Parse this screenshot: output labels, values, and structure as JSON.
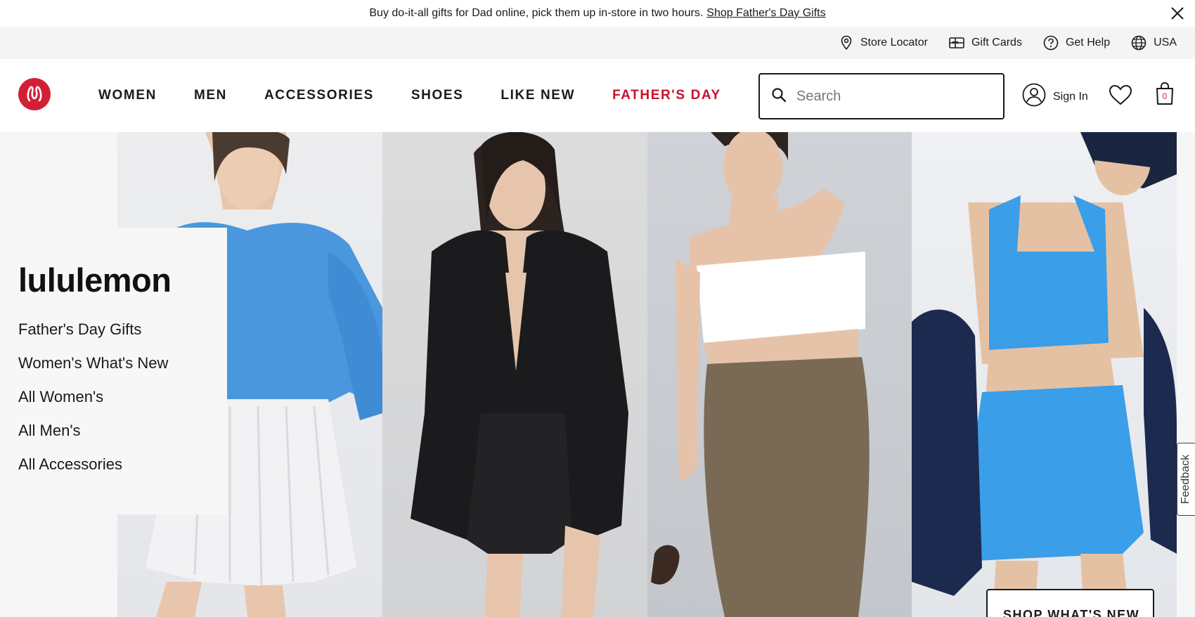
{
  "promo": {
    "text": "Buy do-it-all gifts for Dad online, pick them up in-store in two hours.",
    "link": "Shop Father's Day Gifts"
  },
  "utility": {
    "items": [
      {
        "label": "Store Locator",
        "icon": "map-pin-icon"
      },
      {
        "label": "Gift Cards",
        "icon": "gift-card-icon"
      },
      {
        "label": "Get Help",
        "icon": "help-circle-icon"
      },
      {
        "label": "USA",
        "icon": "globe-icon"
      }
    ]
  },
  "nav": {
    "logo": "lululemon-logo",
    "links": [
      {
        "label": "WOMEN"
      },
      {
        "label": "MEN"
      },
      {
        "label": "ACCESSORIES"
      },
      {
        "label": "SHOES"
      },
      {
        "label": "LIKE NEW"
      },
      {
        "label": "FATHER'S DAY",
        "highlight": true
      }
    ],
    "search_placeholder": "Search",
    "sign_in": "Sign In",
    "bag_count": "0"
  },
  "hero": {
    "brand": "lululemon",
    "links": [
      "Father's Day Gifts",
      "Women's What's New",
      "All Women's",
      "All Men's",
      "All Accessories"
    ],
    "cta": "SHOP WHAT'S NEW",
    "feedback": "Feedback",
    "panels": [
      "model-blue-sweatshirt-white-skirt",
      "model-black-shirt-black-shorts",
      "model-white-bandeau-olive-skirt",
      "model-blue-bra-blue-skirt"
    ]
  },
  "colors": {
    "brand_red": "#d31f35",
    "highlight_red": "#c8102e",
    "sky_blue": "#3a9ee8",
    "text": "#1a1a1a"
  }
}
